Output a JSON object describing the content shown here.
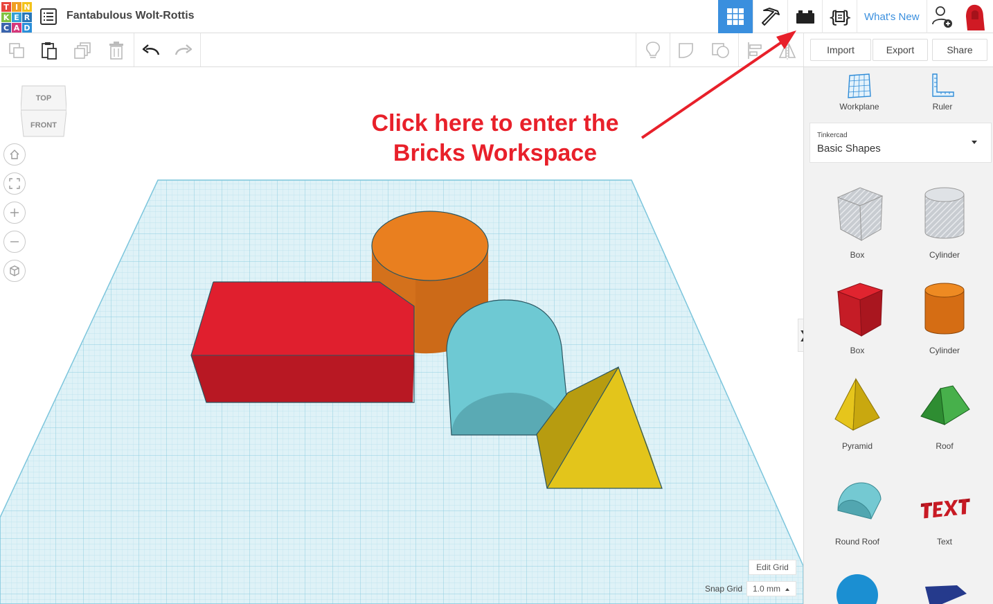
{
  "app": {
    "logo_letters": [
      "T",
      "I",
      "N",
      "K",
      "E",
      "R",
      "C",
      "A",
      "D"
    ],
    "logo_colors": [
      "#e8453c",
      "#f0a022",
      "#f3c219",
      "#7fc241",
      "#34a0d7",
      "#2877b8",
      "#3a64ad",
      "#d5387b",
      "#2b8fd9"
    ],
    "document_title": "Fantabulous Wolt-Rottis"
  },
  "topbar": {
    "views": [
      {
        "name": "3D Design",
        "icon": "grid-icon",
        "active": true
      },
      {
        "name": "Minecraft",
        "icon": "pickaxe-icon",
        "active": false
      },
      {
        "name": "Bricks",
        "icon": "briefcase-icon",
        "active": false
      },
      {
        "name": "Codeblocks",
        "icon": "codeblocks-icon",
        "active": false
      }
    ],
    "whats_new": "What's New",
    "accent": "#3a8fde"
  },
  "toolbar": {
    "import_label": "Import",
    "export_label": "Export",
    "share_label": "Share"
  },
  "workspace": {
    "viewcube": {
      "top": "TOP",
      "front": "FRONT"
    },
    "annotation": [
      "Click here to enter the",
      "Bricks Workspace"
    ],
    "annotation_color": "#e8202a",
    "edit_grid": "Edit Grid",
    "snap_grid_label": "Snap Grid",
    "snap_grid_value": "1.0 mm",
    "collapse_glyph": "❯"
  },
  "sidebar": {
    "workplane_label": "Workplane",
    "ruler_label": "Ruler",
    "library_small": "Tinkercad",
    "library_name": "Basic Shapes",
    "shapes": [
      {
        "label": "Box",
        "icon": "box-hole-icon"
      },
      {
        "label": "Cylinder",
        "icon": "cylinder-hole-icon"
      },
      {
        "label": "Box",
        "icon": "box-icon"
      },
      {
        "label": "Cylinder",
        "icon": "cylinder-icon"
      },
      {
        "label": "Pyramid",
        "icon": "pyramid-icon"
      },
      {
        "label": "Roof",
        "icon": "roof-icon"
      },
      {
        "label": "Round Roof",
        "icon": "round-roof-icon"
      },
      {
        "label": "Text",
        "icon": "text-shape-icon"
      }
    ]
  }
}
